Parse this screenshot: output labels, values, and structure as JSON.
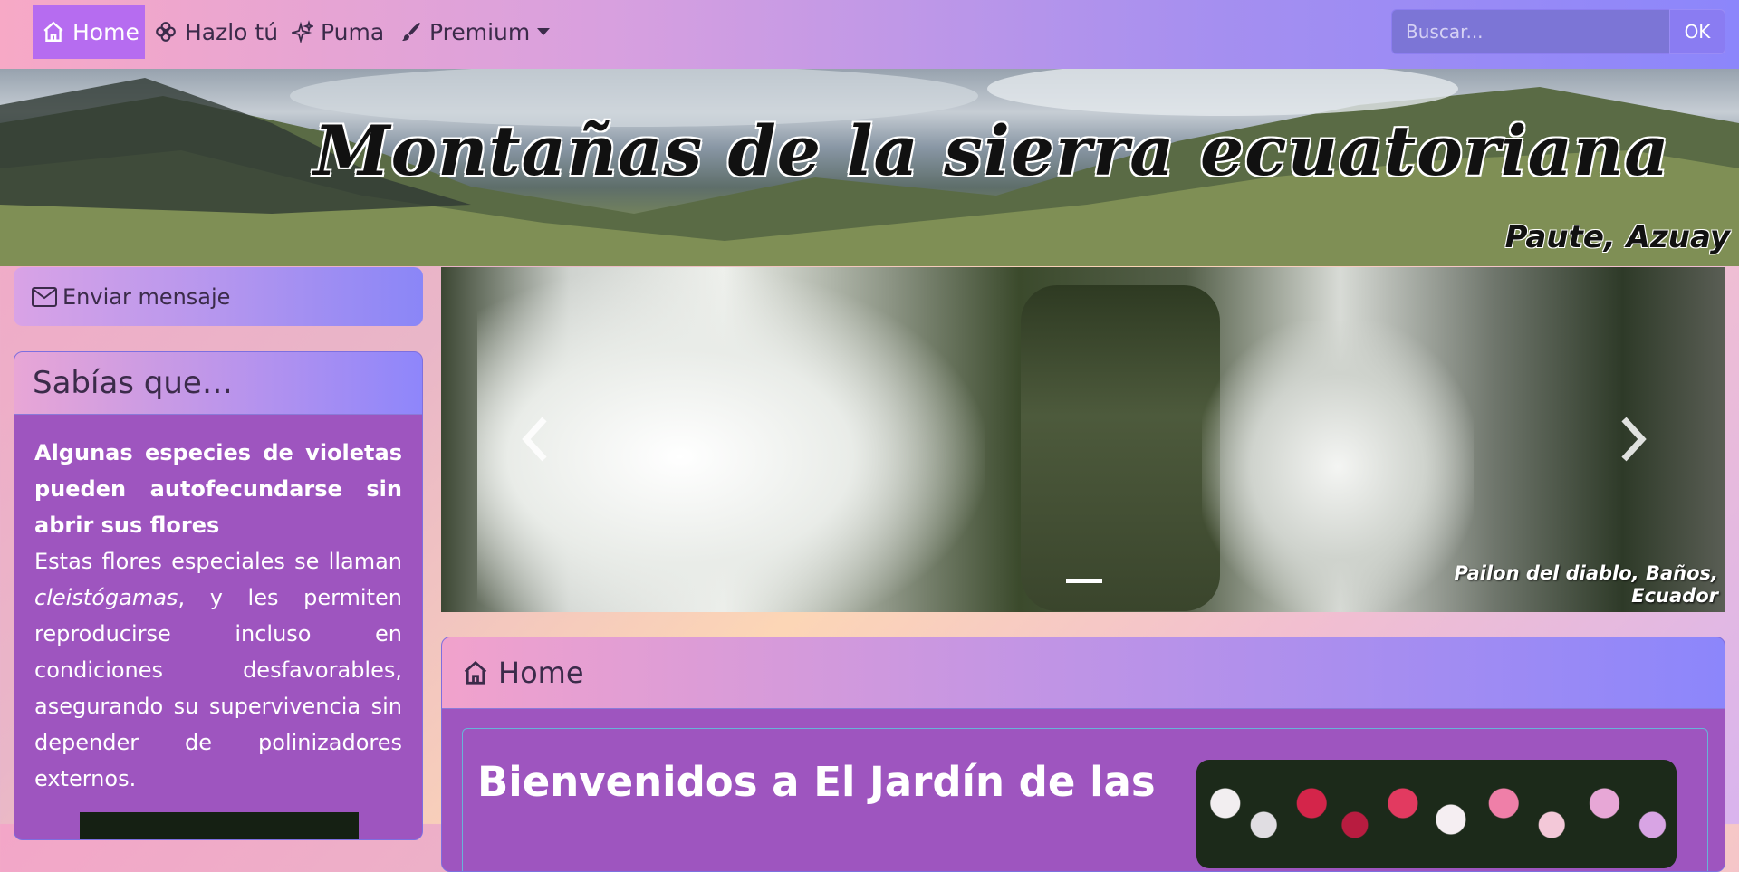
{
  "nav": {
    "items": [
      {
        "label": "Home",
        "icon": "house-icon",
        "active": true
      },
      {
        "label": "Hazlo tú",
        "icon": "flower-icon"
      },
      {
        "label": "Puma",
        "icon": "sparkles-icon"
      },
      {
        "label": "Premium",
        "icon": "brush-icon",
        "dropdown": true
      }
    ],
    "search_placeholder": "Buscar...",
    "search_button": "OK"
  },
  "banner": {
    "title": "Montañas de la sierra ecuatoriana",
    "caption": "Paute, Azuay"
  },
  "sidebar": {
    "message_label": "Enviar mensaje",
    "fact_card": {
      "heading": "Sabías que…",
      "fact_title": "Algunas especies de violetas pueden autofecundarse sin abrir sus flores",
      "fact_text_before": "Estas flores especiales se llaman ",
      "fact_text_em": "cleistógamas",
      "fact_text_after": ", y les permiten reproducirse incluso en condiciones desfavorables, asegurando su supervivencia sin depender de polinizadores externos."
    }
  },
  "carousel": {
    "caption": "Pailon del diablo, Baños, Ecuador"
  },
  "main": {
    "heading": "Home",
    "welcome": "Bienvenidos a El Jardín de las"
  },
  "colors": {
    "nav_active": "#b66cf0",
    "card_body": "#9e55bf"
  }
}
